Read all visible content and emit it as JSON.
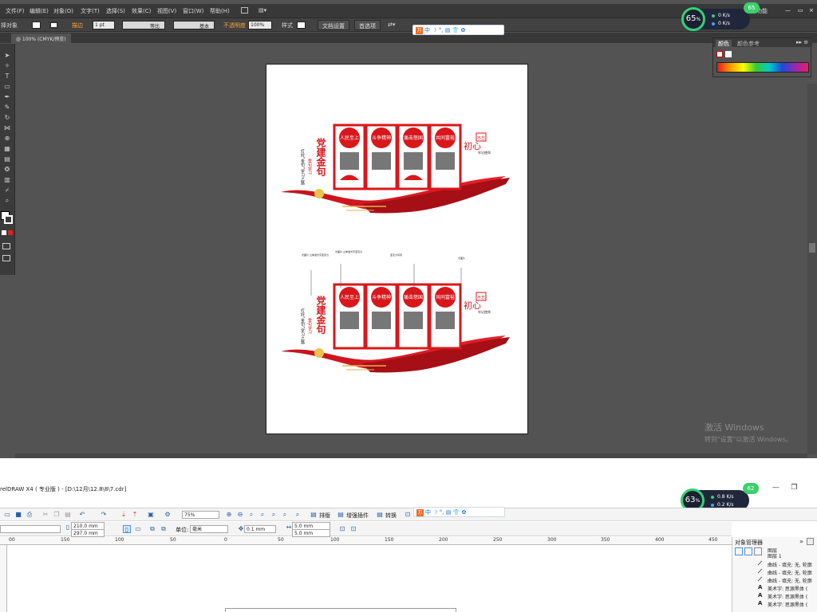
{
  "illustrator": {
    "menu": [
      "文件(F)",
      "编辑(E)",
      "对象(O)",
      "文字(T)",
      "选择(S)",
      "效果(C)",
      "视图(V)",
      "窗口(W)",
      "帮助(H)"
    ],
    "control": {
      "selection": "择对象",
      "stroke_label": "描边",
      "stroke_weight": "1 pt",
      "profile_uniform": "等比",
      "profile_basic": "基本",
      "opacity_label": "不透明度",
      "opacity_value": "100%",
      "style_label": "样式",
      "doc_setup": "文档设置",
      "preferences": "首选项"
    },
    "tab": "@ 100% (CMYK/预览)",
    "panels": {
      "color": "颜色",
      "color_guide": "颜色参考"
    },
    "watermark": {
      "line1": "激活 Windows",
      "line2": "转到\"设置\"以激活 Windows。"
    },
    "top_right_func": "功能"
  },
  "artwork": {
    "title": "党建金句",
    "subtitle": "金句学习",
    "side_text": "打好“金句”学习之路",
    "panels": [
      "人民至上",
      "斗争精神",
      "痛击怒国",
      "共同富裕"
    ],
    "heading_badge": "不忘",
    "heading_big": "初心",
    "heading_small": "牢记使命",
    "annotations": [
      "光面片\n立体发光字亚克力\n",
      "光面片\n立体发光字亚克力\n",
      "亚克力写真\n",
      "光面片\n"
    ]
  },
  "gauges": [
    {
      "percent": "65",
      "unit": "%",
      "up": "0",
      "down": "0",
      "up_unit": "K/s",
      "down_unit": "K/s"
    },
    {
      "percent": "63",
      "unit": "%",
      "up": "0.8",
      "down": "0.2",
      "up_unit": "K/s",
      "down_unit": "K/s"
    }
  ],
  "badges": [
    "65",
    "62"
  ],
  "ime": {
    "logo": "万",
    "lang": "中",
    "items": [
      "☽",
      "°,",
      "▤",
      "👕",
      "✿"
    ]
  },
  "coreldraw": {
    "title": "relDRAW X4 ( 专业版 ) - [D:\\12月\\12.8\\8\\7.cdr]",
    "toolbar1": {
      "zoom": "75%",
      "labels": [
        "排版",
        "增强插件",
        "转换"
      ]
    },
    "toolbar2": {
      "width": "210.0 mm",
      "height": "297.0 mm",
      "unit_label": "单位:",
      "unit_value": "毫米",
      "nudge": "0.1 mm",
      "dup_x": "5.0 mm",
      "dup_y": "5.0 mm"
    },
    "ruler": [
      "00",
      "150",
      "100",
      "50",
      "0",
      "50",
      "100",
      "150",
      "200",
      "250",
      "300",
      "350",
      "400",
      "450"
    ],
    "object_manager": {
      "title": "对象管理器",
      "pages": [
        "图层",
        "图层 1"
      ],
      "rows": [
        {
          "icon": "curve-icon",
          "text": "曲线 - 填充: 无, 轮廓"
        },
        {
          "icon": "curve-icon",
          "text": "曲线 - 填充: 无, 轮廓"
        },
        {
          "icon": "curve-icon",
          "text": "曲线 - 填充: 无, 轮廓"
        },
        {
          "icon": "text-icon",
          "text": "美术字: 思源黑体 ("
        },
        {
          "icon": "text-icon",
          "text": "美术字: 思源黑体 ("
        },
        {
          "icon": "text-icon",
          "text": "美术字: 思源黑体 ("
        }
      ]
    }
  },
  "colors": {
    "ai_bg": "#535353",
    "party_red": "#d9171b",
    "gold": "#e0b34c",
    "gauge_green": "#33d17a"
  }
}
